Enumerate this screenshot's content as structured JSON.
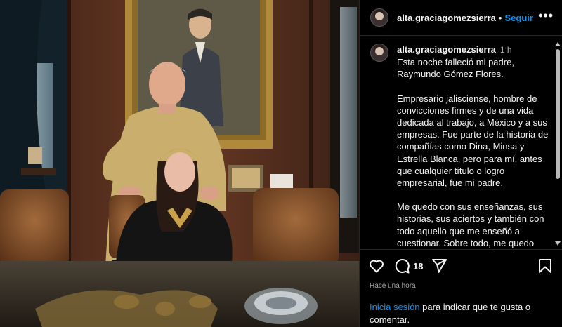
{
  "header": {
    "username": "alta.graciagomezsierra",
    "separator": "•",
    "follow_label": "Seguir",
    "more_icon": "more-options-icon"
  },
  "caption": {
    "username": "alta.graciagomezsierra",
    "time": "1 h",
    "paragraphs": [
      "Esta noche falleció mi padre, Raymundo Gómez Flores.",
      "Empresario jalisciense, hombre de convicciones firmes y de una vida dedicada al trabajo, a México y a sus empresas. Fue parte de la historia de compañías como Dina, Minsa y Estrella Blanca, pero para mí, antes que cualquier título o logro empresarial, fue mi padre.",
      "Me quedo con sus enseñanzas, sus historias, sus aciertos y también con todo aquello que me enseñó a cuestionar. Sobre todo, me quedo con su amor y con el orgullo de haber sido su hija."
    ]
  },
  "actions": {
    "like_icon": "heart-icon",
    "comment_icon": "comment-icon",
    "comment_count": "18",
    "share_icon": "share-icon",
    "save_icon": "bookmark-icon",
    "time_ago": "Hace una hora"
  },
  "login": {
    "link_label": "Inicia sesión",
    "rest": " para indicar que te gusta o comentar."
  },
  "colors": {
    "background": "#000000",
    "text": "#f5f5f5",
    "muted": "#a8a8a8",
    "link": "#0095f6",
    "divider": "#262626"
  }
}
